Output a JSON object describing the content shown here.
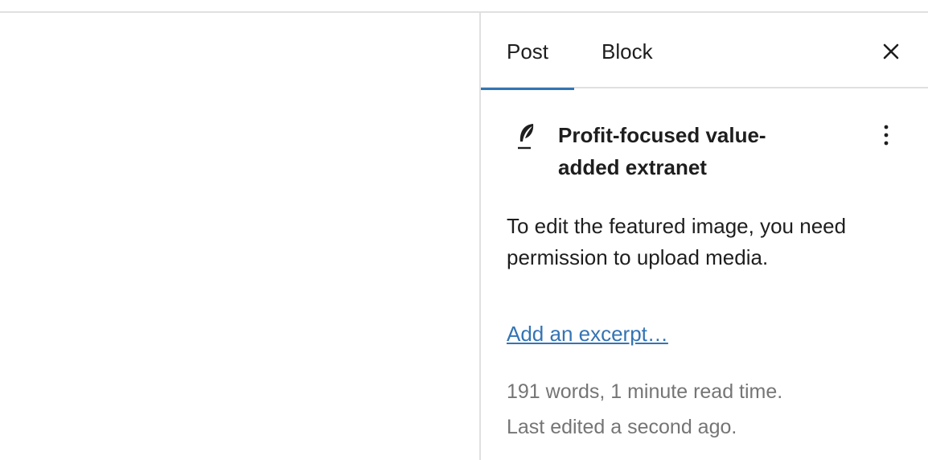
{
  "sidebar": {
    "tabs": [
      {
        "label": "Post",
        "active": true
      },
      {
        "label": "Block",
        "active": false
      }
    ],
    "close_icon": "close-icon",
    "post_summary": {
      "icon": "feather-icon",
      "title": "Profit-focused value-added extranet",
      "more_icon": "more-vertical-icon"
    },
    "featured_image_message": "To edit the featured image, you need permission to upload media.",
    "excerpt_link": "Add an excerpt…",
    "word_count_text": "191 words, 1 minute read time.",
    "last_edited_text": "Last edited a second ago."
  },
  "colors": {
    "accent": "#3474b4",
    "text": "#1e1e1e",
    "muted": "#757575",
    "border": "#e0e0e0"
  }
}
